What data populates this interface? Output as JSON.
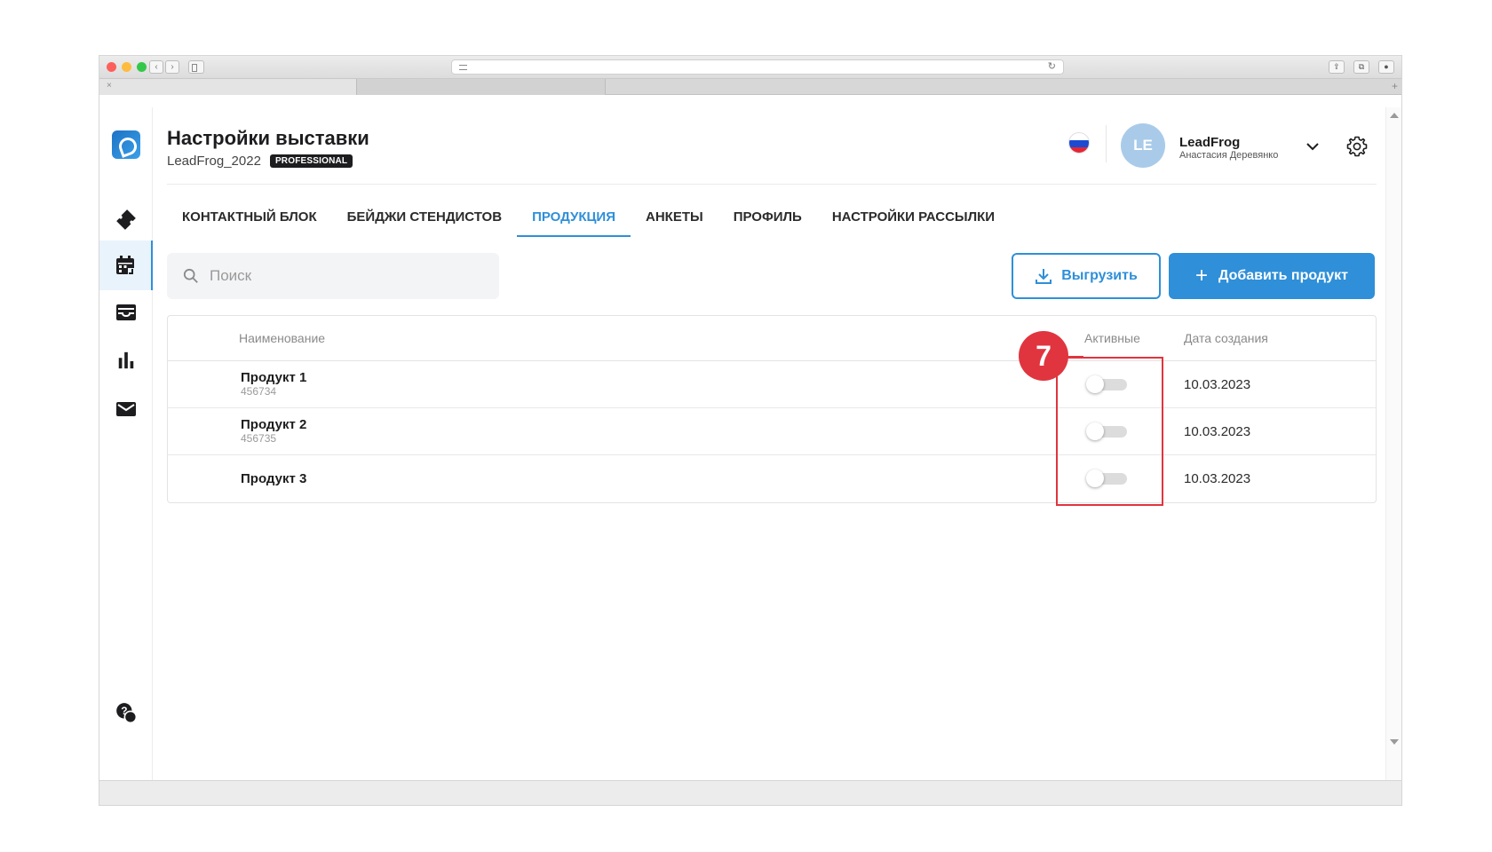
{
  "browser": {
    "reload_glyph": "↻",
    "share_glyph": "⇪",
    "tabs_glyph": "⧉",
    "profile_glyph": "●",
    "tab_close": "×",
    "tab_plus": "+"
  },
  "header": {
    "title": "Настройки выставки",
    "exhibition_name": "LeadFrog_2022",
    "plan_badge": "PROFESSIONAL",
    "user": {
      "initials": "LE",
      "name": "LeadFrog",
      "full_name": "Анастасия Деревянко"
    }
  },
  "sidebar": {
    "items": [
      {
        "icon": "ticket-icon"
      },
      {
        "icon": "calendar-icon",
        "active": true
      },
      {
        "icon": "inbox-icon"
      },
      {
        "icon": "bar-chart-icon"
      },
      {
        "icon": "mail-icon"
      },
      {
        "icon": "help-chat-icon"
      }
    ]
  },
  "tabs": [
    {
      "label": "КОНТАКТНЫЙ БЛОК"
    },
    {
      "label": "БЕЙДЖИ СТЕНДИСТОВ"
    },
    {
      "label": "ПРОДУКЦИЯ",
      "active": true
    },
    {
      "label": "АНКЕТЫ"
    },
    {
      "label": "ПРОФИЛЬ"
    },
    {
      "label": "НАСТРОЙКИ РАССЫЛКИ"
    }
  ],
  "toolbar": {
    "search_placeholder": "Поиск",
    "export_label": "Выгрузить",
    "add_label": "Добавить продукт"
  },
  "table": {
    "columns": {
      "name": "Наименование",
      "active": "Активные",
      "date": "Дата создания"
    },
    "rows": [
      {
        "name": "Продукт 1",
        "sku": "456734",
        "active": false,
        "date": "10.03.2023"
      },
      {
        "name": "Продукт 2",
        "sku": "456735",
        "active": false,
        "date": "10.03.2023"
      },
      {
        "name": "Продукт 3",
        "sku": "",
        "active": false,
        "date": "10.03.2023"
      }
    ]
  },
  "annotation": {
    "marker": "7"
  },
  "colors": {
    "accent": "#2f8fd8",
    "annotation": "#e0353f",
    "badge_bg": "#1d1d1f"
  }
}
